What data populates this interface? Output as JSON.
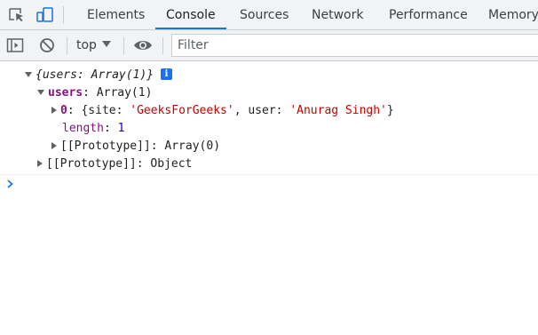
{
  "toolbar_top": {
    "inspect_icon": "inspect-element-icon",
    "device_icon": "device-toolbar-icon",
    "tabs": [
      {
        "label": "Elements"
      },
      {
        "label": "Console"
      },
      {
        "label": "Sources"
      },
      {
        "label": "Network"
      },
      {
        "label": "Performance"
      },
      {
        "label": "Memory"
      }
    ],
    "active_tab": "Console",
    "accent_color": "#1a73e8"
  },
  "console_toolbar": {
    "sidebar_icon": "sidebar-toggle-icon",
    "clear_icon": "clear-console-icon",
    "context": "top",
    "eye_icon": "live-expression-eye-icon",
    "filter_placeholder": "Filter"
  },
  "console": {
    "root": {
      "preview_open": "{",
      "preview_key": "users",
      "preview_sep": ": ",
      "preview_value": "Array(1)",
      "preview_close": "}",
      "info_badge": "i"
    },
    "users": {
      "key": "users",
      "sep": ": ",
      "value": "Array(1)"
    },
    "item0": {
      "index": "0",
      "sep": ": ",
      "open": "{site: ",
      "site_value": "'GeeksForGeeks'",
      "mid": ", user: ",
      "user_value": "'Anurag Singh'",
      "close": "}"
    },
    "length": {
      "key": "length",
      "sep": ": ",
      "value": "1"
    },
    "array_proto": {
      "label": "[[Prototype]]",
      "sep": ": ",
      "value": "Array(0)"
    },
    "object_proto": {
      "label": "[[Prototype]]",
      "sep": ": ",
      "value": "Object"
    },
    "prompt_icon": "prompt-chevron-icon"
  }
}
